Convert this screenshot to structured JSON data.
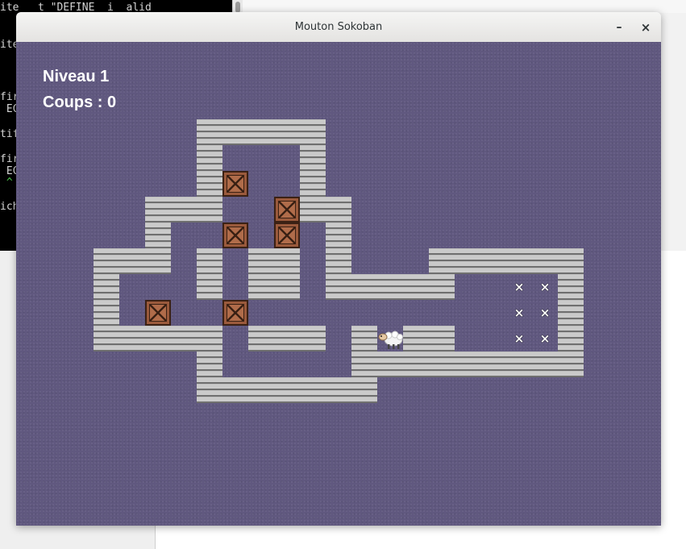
{
  "terminal": {
    "lines": [
      {
        "text": "ite   t \"DEFINE  i  alid",
        "y": 0
      },
      {
        "text": "",
        "y": 0
      },
      {
        "text": "ite",
        "y": 0
      },
      {
        "text": "",
        "y": 0
      },
      {
        "text": "",
        "y": 0
      },
      {
        "text": "fir",
        "y": 0
      },
      {
        "text": " EC",
        "y": 0
      },
      {
        "text": "",
        "y": 0
      },
      {
        "text": "tif",
        "y": 0
      },
      {
        "text": "",
        "y": 0
      },
      {
        "text": "fir",
        "y": 0
      },
      {
        "text": " EC",
        "y": 0
      },
      {
        "text": " ^",
        "y": 0
      },
      {
        "text": "",
        "y": 0
      },
      {
        "text": "ich",
        "y": 0
      }
    ]
  },
  "window": {
    "title": "Mouton Sokoban",
    "minimize_icon": "–",
    "close_icon": "×"
  },
  "hud": {
    "level": "Niveau 1",
    "moves": "Coups : 0"
  },
  "board": {
    "rows": [
      "    #####           ",
      "    #   #           ",
      "    #$  #           ",
      "  ###  $##          ",
      "  #  $ $ #          ",
      "### # ## #   ###### ",
      "#   # ## #####  ..# ",
      "# $  $          ..# ",
      "##### ### #@##  ..# ",
      "    #     ######### ",
      "    #######         "
    ],
    "legend": {
      "#": "wall",
      "$": "crate",
      ".": "goal",
      "@": "sheep"
    },
    "goal_glyph": "×",
    "colors": {
      "background": "#60587f",
      "crate": "#9a5a3c",
      "wall": "#8f8f8f"
    }
  }
}
